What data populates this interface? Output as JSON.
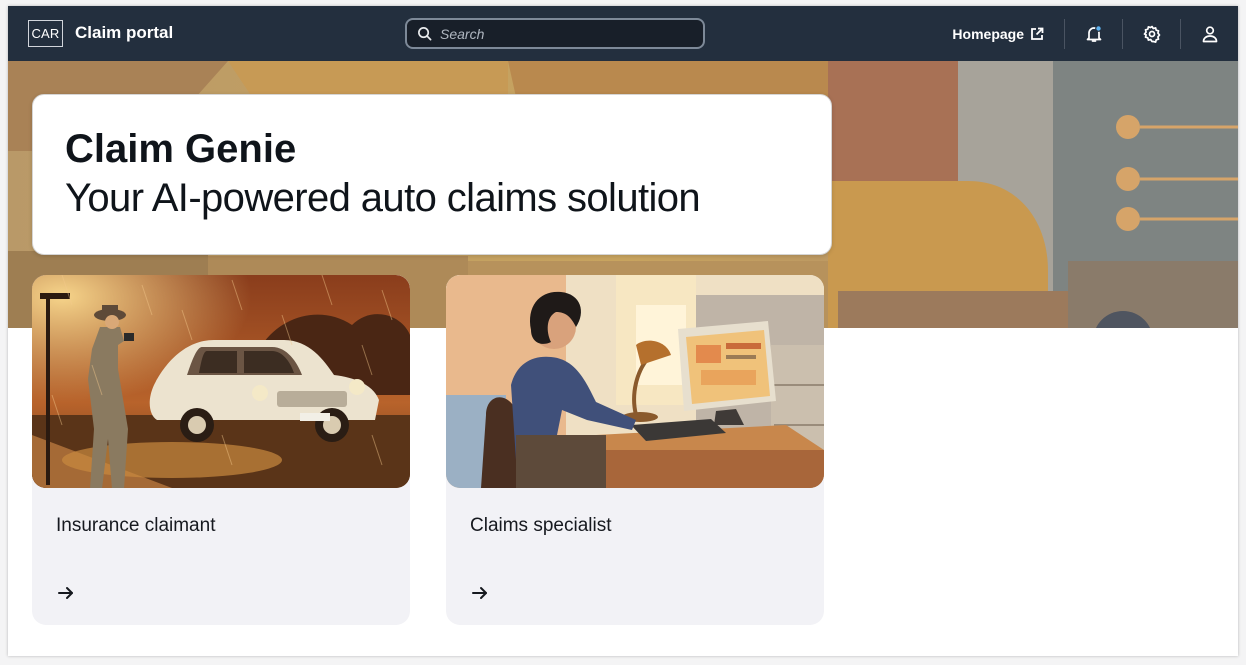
{
  "nav": {
    "logo_text": "CAR",
    "app_title": "Claim portal",
    "search_placeholder": "Search",
    "homepage_label": "Homepage",
    "icons": [
      "external-link-icon",
      "bell-icon",
      "gear-icon",
      "user-icon"
    ]
  },
  "hero": {
    "title": "Claim  Genie",
    "subtitle": "Your AI-powered auto claims solution"
  },
  "roles": [
    {
      "label": "Insurance claimant",
      "image": "rainy-street-car-illustration",
      "arrow": "arrow-right-icon"
    },
    {
      "label": "Claims specialist",
      "image": "office-desk-computer-illustration",
      "arrow": "arrow-right-icon"
    }
  ],
  "colors": {
    "nav_bg": "#232f3e",
    "card_bg": "#f2f2f6",
    "notification_dot": "#5fb3f0"
  }
}
